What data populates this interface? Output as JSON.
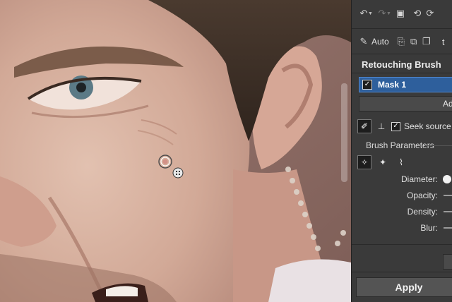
{
  "canvas": {
    "subject": "close-up portrait photo",
    "brush_cursor_icon": "brush-circle-cursor",
    "clone_source_icon": "crosshair-target-icon"
  },
  "toolbar": {
    "row1": [
      "undo-icon",
      "redo-icon",
      "image-icon",
      "rotate-left-icon",
      "rotate-right-icon"
    ],
    "auto_label": "Auto",
    "row2": [
      "magic-wand-icon",
      "copy-icon",
      "paste-icon",
      "duplicate-icon",
      "text-icon"
    ]
  },
  "panel": {
    "title": "Retouching Brush",
    "mask": {
      "label": "Mask 1",
      "checked": true
    },
    "add_button_label": "Ad",
    "seek_source": {
      "label": "Seek source",
      "checked": true
    },
    "group_label": "Brush Parameters",
    "params": [
      {
        "label": "Diameter:"
      },
      {
        "label": "Opacity:"
      },
      {
        "label": "Density:"
      },
      {
        "label": "Blur:"
      }
    ],
    "apply_label": "Apply"
  },
  "colors": {
    "panel_bg": "#3a3a3a",
    "mask_selected": "#2e5f9c",
    "accent": "#4f87cf"
  }
}
